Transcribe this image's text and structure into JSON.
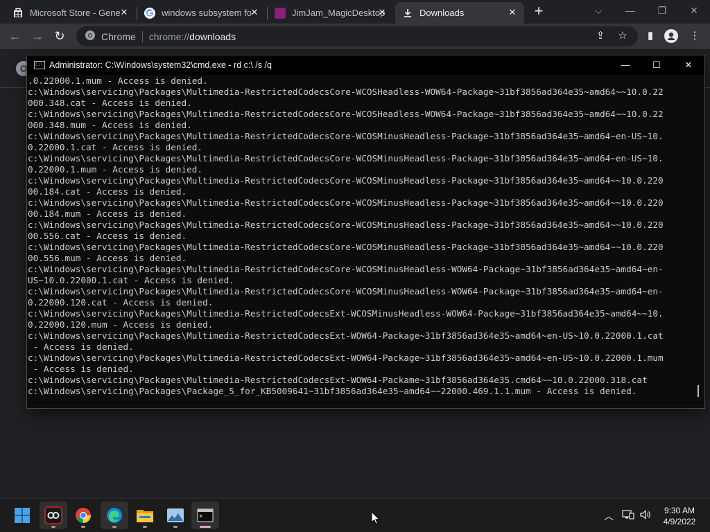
{
  "browser": {
    "tabs": [
      {
        "title": "Microsoft Store - Gene",
        "favicon": "store-icon",
        "active": false
      },
      {
        "title": "windows subsystem fo",
        "favicon": "google-icon",
        "active": false
      },
      {
        "title": "JimJam_MagicDesktop",
        "favicon": "jimjam-icon",
        "active": false
      },
      {
        "title": "Downloads",
        "favicon": "download-icon",
        "active": true
      }
    ],
    "omnibox": {
      "site_label": "Chrome",
      "scheme": "chrome://",
      "host": "downloads"
    }
  },
  "cmd": {
    "title": "Administrator: C:\\Windows\\system32\\cmd.exe - rd  c:\\ /s /q",
    "lines": [
      ".0.22000.1.mum - Access is denied.",
      "c:\\Windows\\servicing\\Packages\\Multimedia-RestrictedCodecsCore-WCOSHeadless-WOW64-Package~31bf3856ad364e35~amd64~~10.0.22",
      "000.348.cat - Access is denied.",
      "c:\\Windows\\servicing\\Packages\\Multimedia-RestrictedCodecsCore-WCOSHeadless-WOW64-Package~31bf3856ad364e35~amd64~~10.0.22",
      "000.348.mum - Access is denied.",
      "c:\\Windows\\servicing\\Packages\\Multimedia-RestrictedCodecsCore-WCOSMinusHeadless-Package~31bf3856ad364e35~amd64~en-US~10.",
      "0.22000.1.cat - Access is denied.",
      "c:\\Windows\\servicing\\Packages\\Multimedia-RestrictedCodecsCore-WCOSMinusHeadless-Package~31bf3856ad364e35~amd64~en-US~10.",
      "0.22000.1.mum - Access is denied.",
      "c:\\Windows\\servicing\\Packages\\Multimedia-RestrictedCodecsCore-WCOSMinusHeadless-Package~31bf3856ad364e35~amd64~~10.0.220",
      "00.184.cat - Access is denied.",
      "c:\\Windows\\servicing\\Packages\\Multimedia-RestrictedCodecsCore-WCOSMinusHeadless-Package~31bf3856ad364e35~amd64~~10.0.220",
      "00.184.mum - Access is denied.",
      "c:\\Windows\\servicing\\Packages\\Multimedia-RestrictedCodecsCore-WCOSMinusHeadless-Package~31bf3856ad364e35~amd64~~10.0.220",
      "00.556.cat - Access is denied.",
      "c:\\Windows\\servicing\\Packages\\Multimedia-RestrictedCodecsCore-WCOSMinusHeadless-Package~31bf3856ad364e35~amd64~~10.0.220",
      "00.556.mum - Access is denied.",
      "c:\\Windows\\servicing\\Packages\\Multimedia-RestrictedCodecsCore-WCOSMinusHeadless-WOW64-Package~31bf3856ad364e35~amd64~en-",
      "US~10.0.22000.1.cat - Access is denied.",
      "c:\\Windows\\servicing\\Packages\\Multimedia-RestrictedCodecsCore-WCOSMinusHeadless-WOW64-Package~31bf3856ad364e35~amd64~en-",
      "0.22000.120.cat - Access is denied.",
      "c:\\Windows\\servicing\\Packages\\Multimedia-RestrictedCodecsExt-WCOSMinusHeadless-WOW64-Package~31bf3856ad364e35~amd64~~10.",
      "0.22000.120.mum - Access is denied.",
      "c:\\Windows\\servicing\\Packages\\Multimedia-RestrictedCodecsExt-WOW64-Package~31bf3856ad364e35~amd64~en-US~10.0.22000.1.cat",
      " - Access is denied.",
      "c:\\Windows\\servicing\\Packages\\Multimedia-RestrictedCodecsExt-WOW64-Package~31bf3856ad364e35~amd64~en-US~10.0.22000.1.mum",
      " - Access is denied.",
      "c:\\Windows\\servicing\\Packages\\Multimedia-RestrictedCodecsExt-WOW64-Packame~31bf3856ad364e35.cmd64~~10.0.22000.318.cat",
      "c:\\Windows\\servicing\\Packages\\Package_5_for_KB5009641~31bf3856ad364e35~amd64~~22000.469.1.1.mum - Access is denied."
    ]
  },
  "taskbar": {
    "apps": [
      "start-icon",
      "creative-cloud-icon",
      "chrome-icon",
      "edge-icon",
      "file-explorer-icon",
      "photos-icon",
      "terminal-icon"
    ],
    "clock": {
      "time": "9:30 AM",
      "date": "4/9/2022"
    }
  }
}
